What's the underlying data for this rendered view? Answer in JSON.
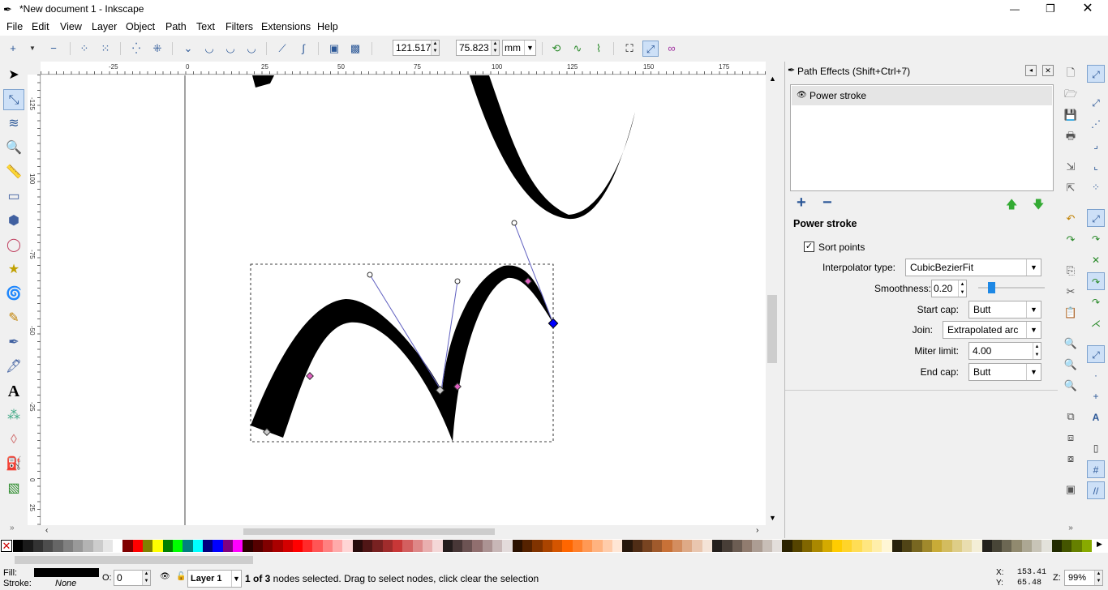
{
  "window": {
    "title": "*New document 1 - Inkscape",
    "minimize": "—",
    "maximize": "❐",
    "close": "✕"
  },
  "menu": [
    "File",
    "Edit",
    "View",
    "Layer",
    "Object",
    "Path",
    "Text",
    "Filters",
    "Extensions",
    "Help"
  ],
  "toolbar": {
    "x_label": "X:",
    "x_value": "121.517",
    "y_label": "Y:",
    "y_value": "75.823",
    "unit": "mm"
  },
  "rulers": {
    "h_ticks": [
      "-25",
      "0",
      "25",
      "50",
      "75",
      "100",
      "125",
      "150",
      "175"
    ],
    "v_ticks": [
      "-125",
      "100",
      "-75",
      "-50",
      "-25",
      "0",
      "25"
    ]
  },
  "dock": {
    "title": "Path Effects  (Shift+Ctrl+7)",
    "effects": [
      "Power stroke"
    ],
    "effect_heading": "Power stroke",
    "sort_points": {
      "label": "Sort points",
      "checked": true
    },
    "interpolator": {
      "label": "Interpolator type:",
      "value": "CubicBezierFit"
    },
    "smoothness": {
      "label": "Smoothness:",
      "value": "0.20",
      "slider_fraction": 0.2
    },
    "start_cap": {
      "label": "Start cap:",
      "value": "Butt"
    },
    "join": {
      "label": "Join:",
      "value": "Extrapolated arc"
    },
    "miter": {
      "label": "Miter limit:",
      "value": "4.00"
    },
    "end_cap": {
      "label": "End cap:",
      "value": "Butt"
    }
  },
  "palette": {
    "colors": [
      "#000000",
      "#1a1a1a",
      "#333333",
      "#4d4d4d",
      "#666666",
      "#808080",
      "#999999",
      "#b3b3b3",
      "#cccccc",
      "#e6e6e6",
      "#ffffff",
      "#800000",
      "#ff0000",
      "#808000",
      "#ffff00",
      "#008000",
      "#00ff00",
      "#008080",
      "#00ffff",
      "#000080",
      "#0000ff",
      "#800080",
      "#ff00ff",
      "#2b0000",
      "#550000",
      "#800000",
      "#aa0000",
      "#d40000",
      "#ff0000",
      "#ff2a2a",
      "#ff5555",
      "#ff8080",
      "#ffaaaa",
      "#ffd5d5",
      "#280b0b",
      "#501616",
      "#782121",
      "#a02c2c",
      "#c83737",
      "#d35f5f",
      "#de8787",
      "#e9afaf",
      "#f4d7d7",
      "#241c1c",
      "#483737",
      "#6c5353",
      "#916f6f",
      "#ac9393",
      "#c8b7b7",
      "#e3dbdb",
      "#2b1100",
      "#552200",
      "#803300",
      "#aa4400",
      "#d45500",
      "#ff6600",
      "#ff7f2a",
      "#ff9955",
      "#ffb380",
      "#ffccaa",
      "#ffe6d5",
      "#28170b",
      "#502d16",
      "#784421",
      "#a05a2c",
      "#c87137",
      "#d38d5f",
      "#deaa87",
      "#e9c6af",
      "#f4e3d7",
      "#241f1c",
      "#483e37",
      "#6c5d53",
      "#917c6f",
      "#ac9d93",
      "#c8beb7",
      "#e3dedb",
      "#2b2200",
      "#554400",
      "#806600",
      "#aa8800",
      "#d4aa00",
      "#ffcc00",
      "#ffd42a",
      "#ffdd55",
      "#ffe680",
      "#ffeeaa",
      "#fff6d5",
      "#28220b",
      "#504416",
      "#786721",
      "#a0892c",
      "#c8ab37",
      "#d3bc5f",
      "#decd87",
      "#e9ddaf",
      "#f4eed7",
      "#24221c",
      "#484537",
      "#6c6753",
      "#918a6f",
      "#aca793",
      "#c8c4b7",
      "#e3e2db",
      "#222b00",
      "#445500",
      "#668000",
      "#88aa00"
    ]
  },
  "status": {
    "fill_label": "Fill:",
    "stroke_label": "Stroke:",
    "stroke_value": "None",
    "opacity_label": "O:",
    "opacity_value": "0",
    "layer": "Layer 1",
    "message_bold": "1 of 3",
    "message": " nodes selected. Drag to select nodes, click clear the selection",
    "x_label": "X:",
    "x_value": "153.41",
    "y_label": "Y:",
    "y_value": "65.48",
    "zoom_label": "Z:",
    "zoom_value": "99%"
  }
}
